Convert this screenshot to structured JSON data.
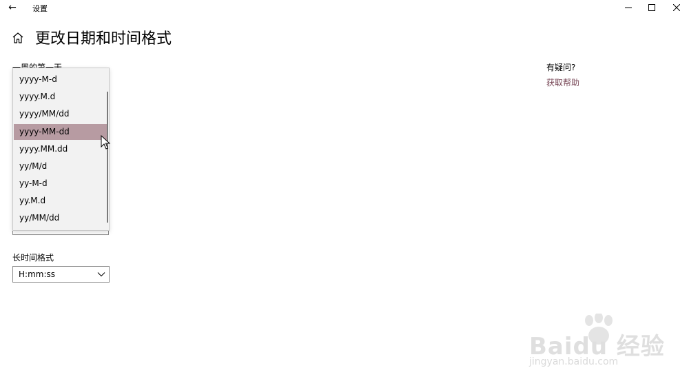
{
  "window": {
    "app_title": "设置",
    "back_glyph": "←",
    "controls": [
      "minimize-icon",
      "maximize-icon",
      "close-icon"
    ]
  },
  "page": {
    "title": "更改日期和时间格式",
    "home_icon": "home-icon"
  },
  "first_day": {
    "label": "一周的第一天"
  },
  "short_date_dropdown": {
    "options": [
      "yyyy-M-d",
      "yyyy.M.d",
      "yyyy/MM/dd",
      "yyyy-MM-dd",
      "yyyy.MM.dd",
      "yy/M/d",
      "yy-M-d",
      "yy.M.d",
      "yy/MM/dd"
    ],
    "selected": "yyyy-MM-dd",
    "highlight_color": "#b79ba2"
  },
  "long_time": {
    "label": "长时间格式",
    "value": "H:mm:ss"
  },
  "help": {
    "question": "有疑问?",
    "link": "获取帮助",
    "link_color": "#7a4a59"
  },
  "watermark": {
    "brand": "Bai",
    "brand_mid": "du",
    "brand_cn": "经验",
    "url": "jingyan.baidu.com"
  }
}
